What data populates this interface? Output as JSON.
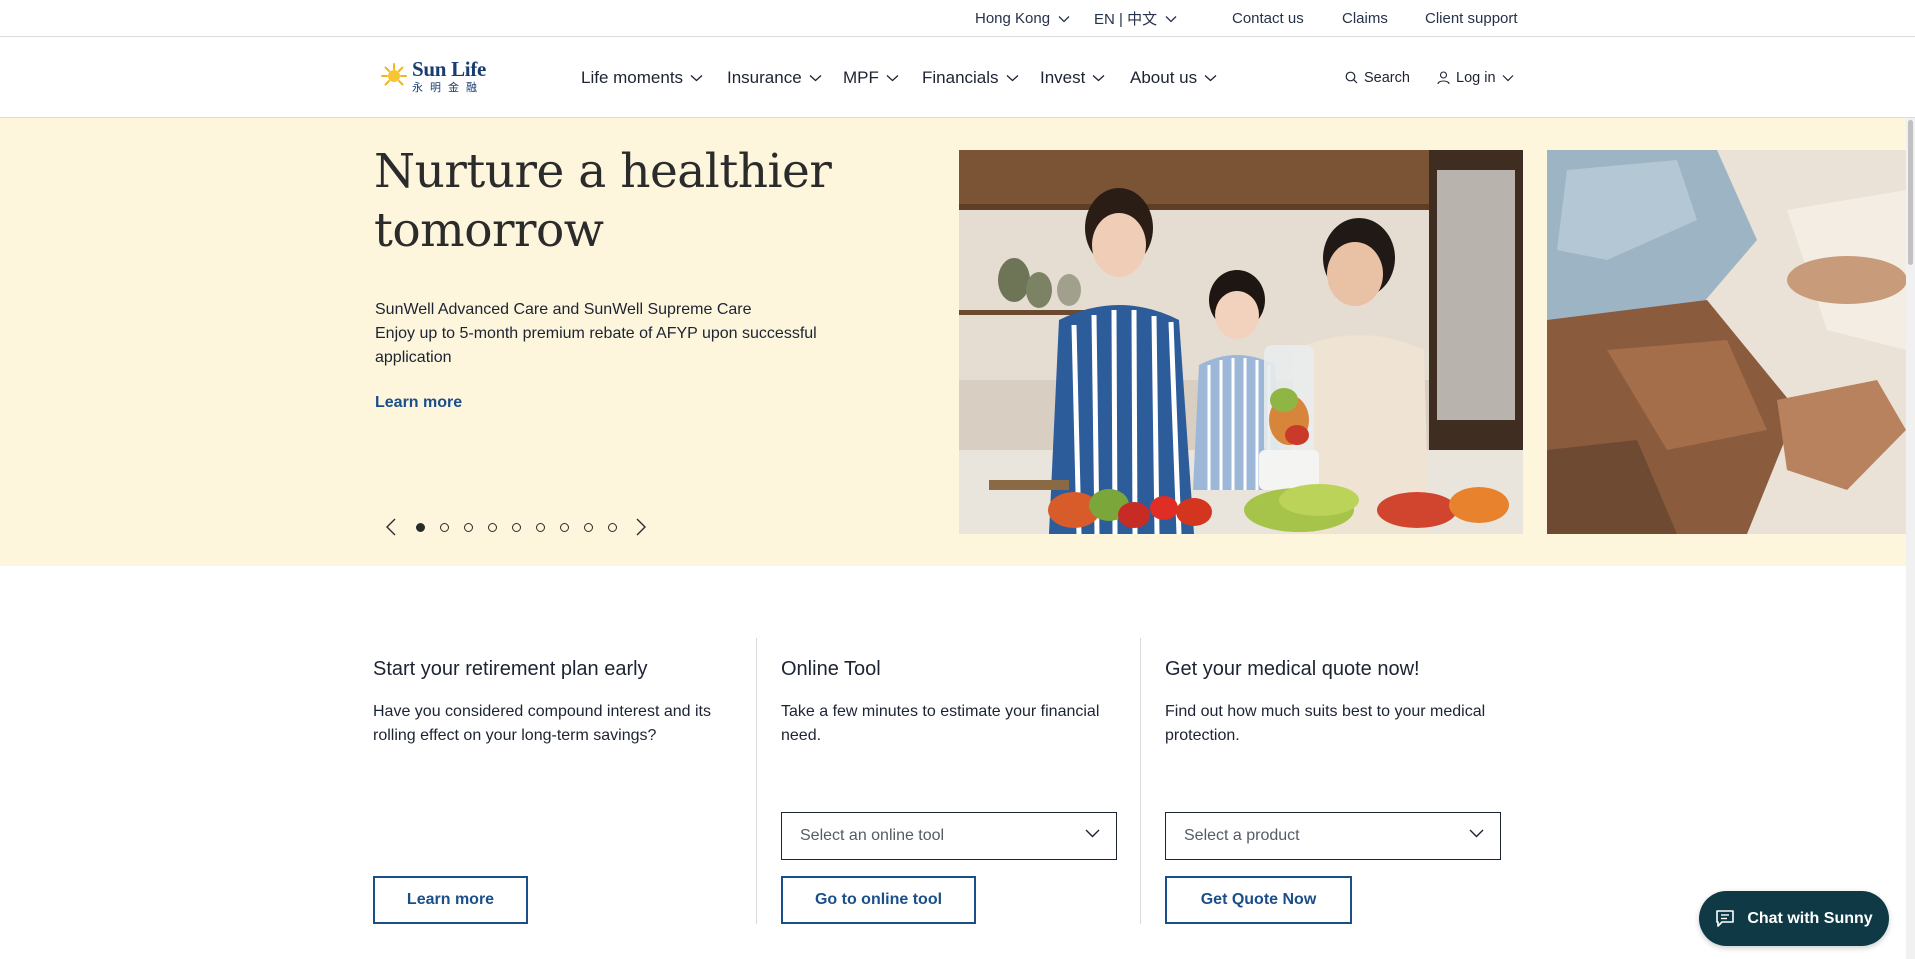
{
  "utility_bar": {
    "region": "Hong Kong",
    "language": "EN | 中文",
    "contact": "Contact us",
    "claims": "Claims",
    "support": "Client support"
  },
  "logo": {
    "text_en": "Sun Life",
    "text_zh": "永明金融"
  },
  "nav": {
    "items": [
      {
        "label": "Life moments"
      },
      {
        "label": "Insurance"
      },
      {
        "label": "MPF"
      },
      {
        "label": "Financials"
      },
      {
        "label": "Invest"
      },
      {
        "label": "About us"
      }
    ],
    "search": "Search",
    "login": "Log in"
  },
  "hero": {
    "title_line1": "Nurture a healthier",
    "title_line2": "tomorrow",
    "subtitle_line1": "SunWell Advanced Care and SunWell Supreme Care",
    "subtitle_line2": "Enjoy up to 5-month premium rebate of AFYP upon successful application",
    "link": "Learn more",
    "slide_count": 9,
    "active_slide": 1
  },
  "cards": [
    {
      "title": "Start your retirement plan early",
      "description": "Have you considered compound interest and its rolling effect on your long-term savings?",
      "button": "Learn more"
    },
    {
      "title": "Online Tool",
      "description": "Take a few minutes to estimate your financial need.",
      "select_placeholder": "Select an online tool",
      "button": "Go to online tool"
    },
    {
      "title": "Get your medical quote now!",
      "description": "Find out how much suits best to your medical protection.",
      "select_placeholder": "Select a product",
      "button": "Get Quote Now"
    }
  ],
  "chat": {
    "label": "Chat with Sunny"
  },
  "colors": {
    "brand_blue": "#1b4f8a",
    "hero_bg": "#fdf6dd",
    "chat_bg": "#0f3a45",
    "logo_gold": "#f2b51c"
  }
}
